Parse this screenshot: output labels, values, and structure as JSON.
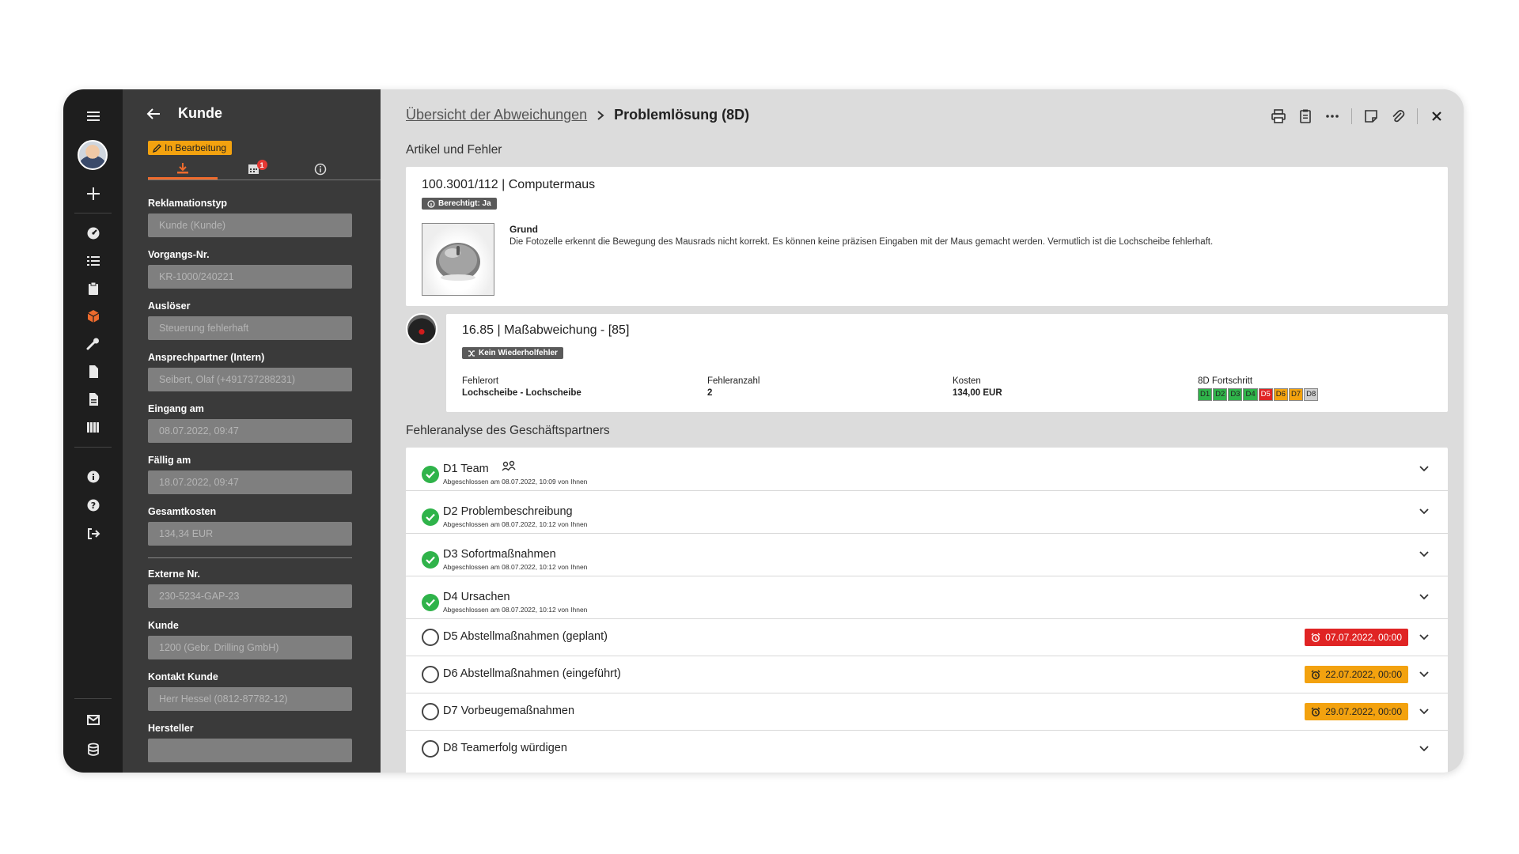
{
  "sidebar": {
    "title": "Kunde",
    "status": "In Bearbeitung",
    "tab_badge_count": "1",
    "fields": [
      {
        "label": "Reklamationstyp",
        "value": "Kunde (Kunde)"
      },
      {
        "label": "Vorgangs-Nr.",
        "value": "KR-1000/240221"
      },
      {
        "label": "Auslöser",
        "value": "Steuerung fehlerhaft"
      },
      {
        "label": "Ansprechpartner (Intern)",
        "value": "Seibert, Olaf (+491737288231)"
      },
      {
        "label": "Eingang am",
        "value": "08.07.2022, 09:47"
      },
      {
        "label": "Fällig am",
        "value": "18.07.2022, 09:47"
      },
      {
        "label": "Gesamtkosten",
        "value": "134,34 EUR"
      },
      {
        "label": "Externe Nr.",
        "value": "230-5234-GAP-23"
      },
      {
        "label": "Kunde",
        "value": "1200 (Gebr. Drilling GmbH)"
      },
      {
        "label": "Kontakt Kunde",
        "value": "Herr Hessel (0812-87782-12)"
      },
      {
        "label": "Hersteller",
        "value": ""
      }
    ]
  },
  "breadcrumb": {
    "link": "Übersicht der Abweichungen",
    "current": "Problemlösung (8D)"
  },
  "sections": {
    "article": "Artikel und Fehler",
    "analysis": "Fehleranalyse des Geschäftspartners"
  },
  "article": {
    "title": "100.3001/112 | Computermaus",
    "chip": "Berechtigt: Ja",
    "reason_label": "Grund",
    "reason_text": "Die Fotozelle erkennt die Bewegung des Mausrads nicht korrekt. Es können keine präzisen Eingaben mit der Maus gemacht werden. Vermutlich ist die Lochscheibe fehlerhaft."
  },
  "defect": {
    "title": "16.85 | Maßabweichung - [85]",
    "chip": "Kein Wiederholfehler",
    "location_label": "Fehlerort",
    "location": "Lochscheibe - Lochscheibe",
    "count_label": "Fehleranzahl",
    "count": "2",
    "cost_label": "Kosten",
    "cost": "134,00 EUR",
    "progress_label": "8D Fortschritt",
    "progress": [
      {
        "label": "D1",
        "color": "#2fb34a"
      },
      {
        "label": "D2",
        "color": "#2fb34a"
      },
      {
        "label": "D3",
        "color": "#2fb34a"
      },
      {
        "label": "D4",
        "color": "#2fb34a"
      },
      {
        "label": "D5",
        "color": "#e02424"
      },
      {
        "label": "D6",
        "color": "#f3a20f"
      },
      {
        "label": "D7",
        "color": "#f3a20f"
      },
      {
        "label": "D8",
        "color": "#cfcfcf"
      }
    ]
  },
  "steps": [
    {
      "title": "D1 Team",
      "sub": "Abgeschlossen am 08.07.2022, 10:09 von Ihnen",
      "done": true
    },
    {
      "title": "D2 Problembeschreibung",
      "sub": "Abgeschlossen am 08.07.2022, 10:12 von Ihnen",
      "done": true
    },
    {
      "title": "D3 Sofortmaßnahmen",
      "sub": "Abgeschlossen am 08.07.2022, 10:12 von Ihnen",
      "done": true
    },
    {
      "title": "D4 Ursachen",
      "sub": "Abgeschlossen am 08.07.2022, 10:12 von Ihnen",
      "done": true
    },
    {
      "title": "D5 Abstellmaßnahmen (geplant)",
      "due": "07.07.2022, 00:00",
      "due_color": "red",
      "done": false
    },
    {
      "title": "D6 Abstellmaßnahmen (eingeführt)",
      "due": "22.07.2022, 00:00",
      "due_color": "orange",
      "done": false
    },
    {
      "title": "D7 Vorbeugemaßnahmen",
      "due": "29.07.2022, 00:00",
      "due_color": "orange",
      "done": false
    },
    {
      "title": "D8 Teamerfolg würdigen",
      "done": false
    }
  ]
}
